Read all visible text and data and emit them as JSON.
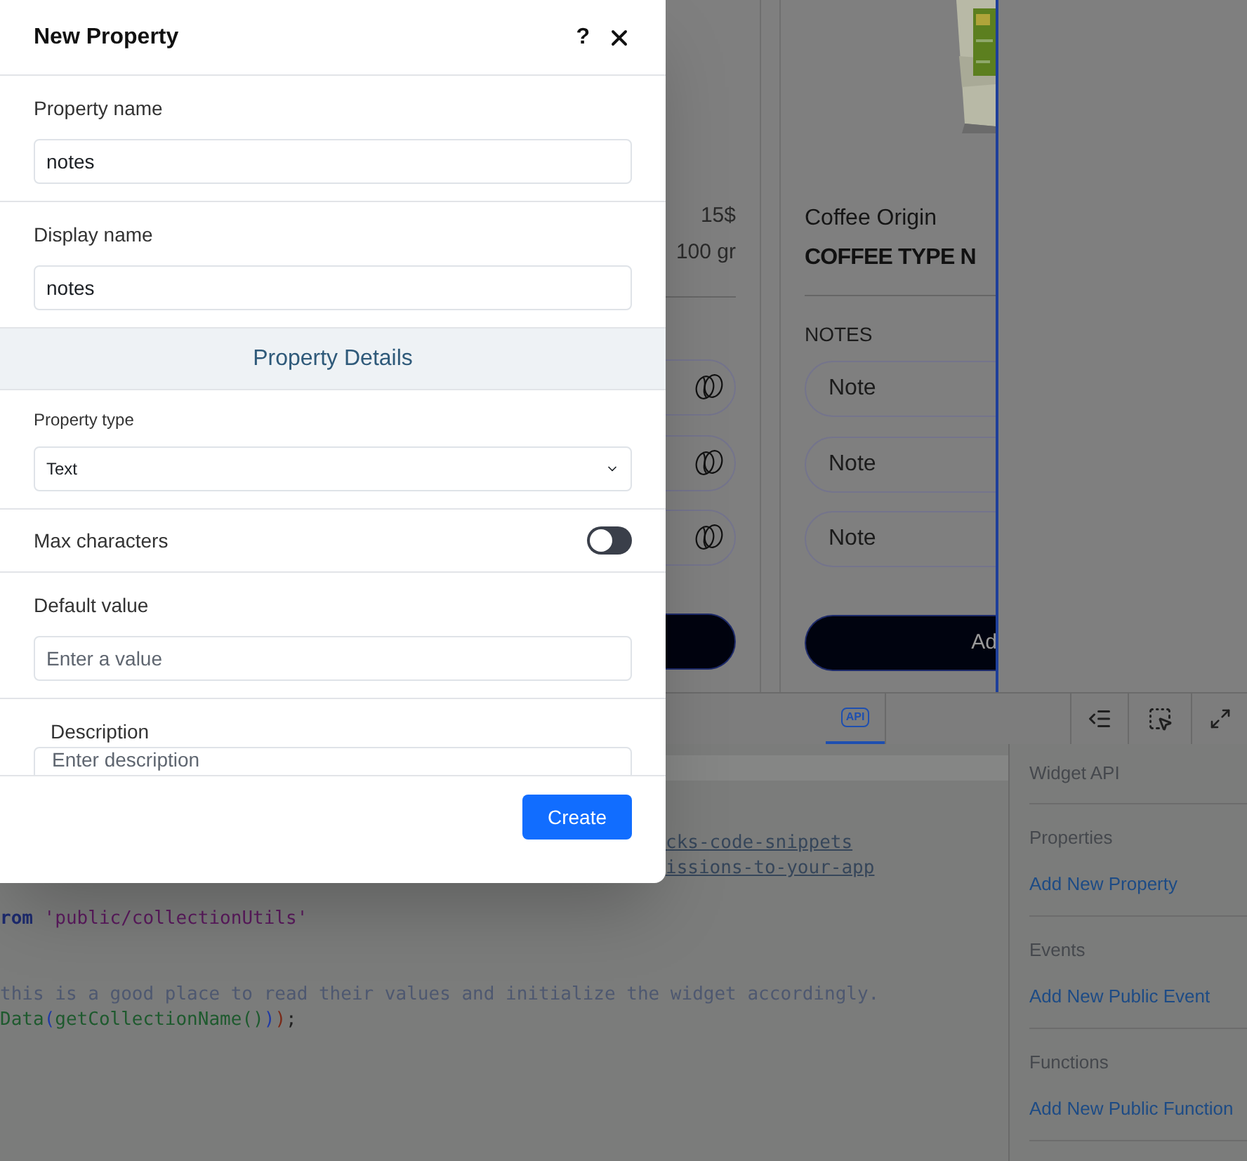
{
  "canvas": {
    "card_1": {
      "price": "15$",
      "weight": "100 gr"
    },
    "card_2": {
      "origin": "Coffee Origin",
      "name": "COFFEE TYPE N",
      "notes_label": "NOTES",
      "notes": [
        "Note",
        "Note",
        "Note"
      ],
      "button": "Ad"
    }
  },
  "toolbar": {
    "tabs": [
      {
        "label": "API",
        "selected": true
      }
    ]
  },
  "code": {
    "lines": [
      {
        "tokens": [
          {
            "text": "cks-code-snippets",
            "kind": "link"
          }
        ]
      },
      {
        "tokens": [
          {
            "text": "issions-to-your-app",
            "kind": "link"
          }
        ]
      },
      {
        "tokens": [
          {
            "text": "rom",
            "kind": "keyword"
          },
          {
            "text": " 'public/collectionUtils'",
            "kind": "string"
          }
        ]
      },
      {
        "tokens": [
          {
            "text": "this is a good place to read their values and initialize the widget accordingly.",
            "kind": "comment"
          }
        ]
      },
      {
        "tokens": [
          {
            "text": "Data",
            "kind": "function"
          },
          {
            "text": "(",
            "kind": "paren"
          },
          {
            "text": "getCollectionName()",
            "kind": "function"
          },
          {
            "text": ")",
            "kind": "paren"
          },
          {
            "text": ")",
            "kind": "bracket"
          },
          {
            "text": ";",
            "kind": "plain"
          }
        ]
      }
    ]
  },
  "api_panel": {
    "title": "Widget API",
    "sections": [
      {
        "heading": "Properties",
        "link": "Add New Property"
      },
      {
        "heading": "Events",
        "link": "Add New Public Event"
      },
      {
        "heading": "Functions",
        "link": "Add New Public Function"
      }
    ]
  },
  "modal": {
    "title": "New Property",
    "help": "?",
    "items": [
      {
        "kind": "input",
        "label": "Property name",
        "value": "notes"
      },
      {
        "kind": "input",
        "label": "Display name",
        "value": "notes"
      },
      {
        "kind": "header",
        "label": "Property Details"
      },
      {
        "kind": "select",
        "label": "Property type",
        "value": "Text"
      },
      {
        "kind": "toggle",
        "label": "Max characters",
        "on": false
      },
      {
        "kind": "input",
        "label": "Default value",
        "placeholder": "Enter a value"
      },
      {
        "kind": "description",
        "label": "Description",
        "placeholder": "Enter description"
      }
    ],
    "create_button": "Create"
  }
}
